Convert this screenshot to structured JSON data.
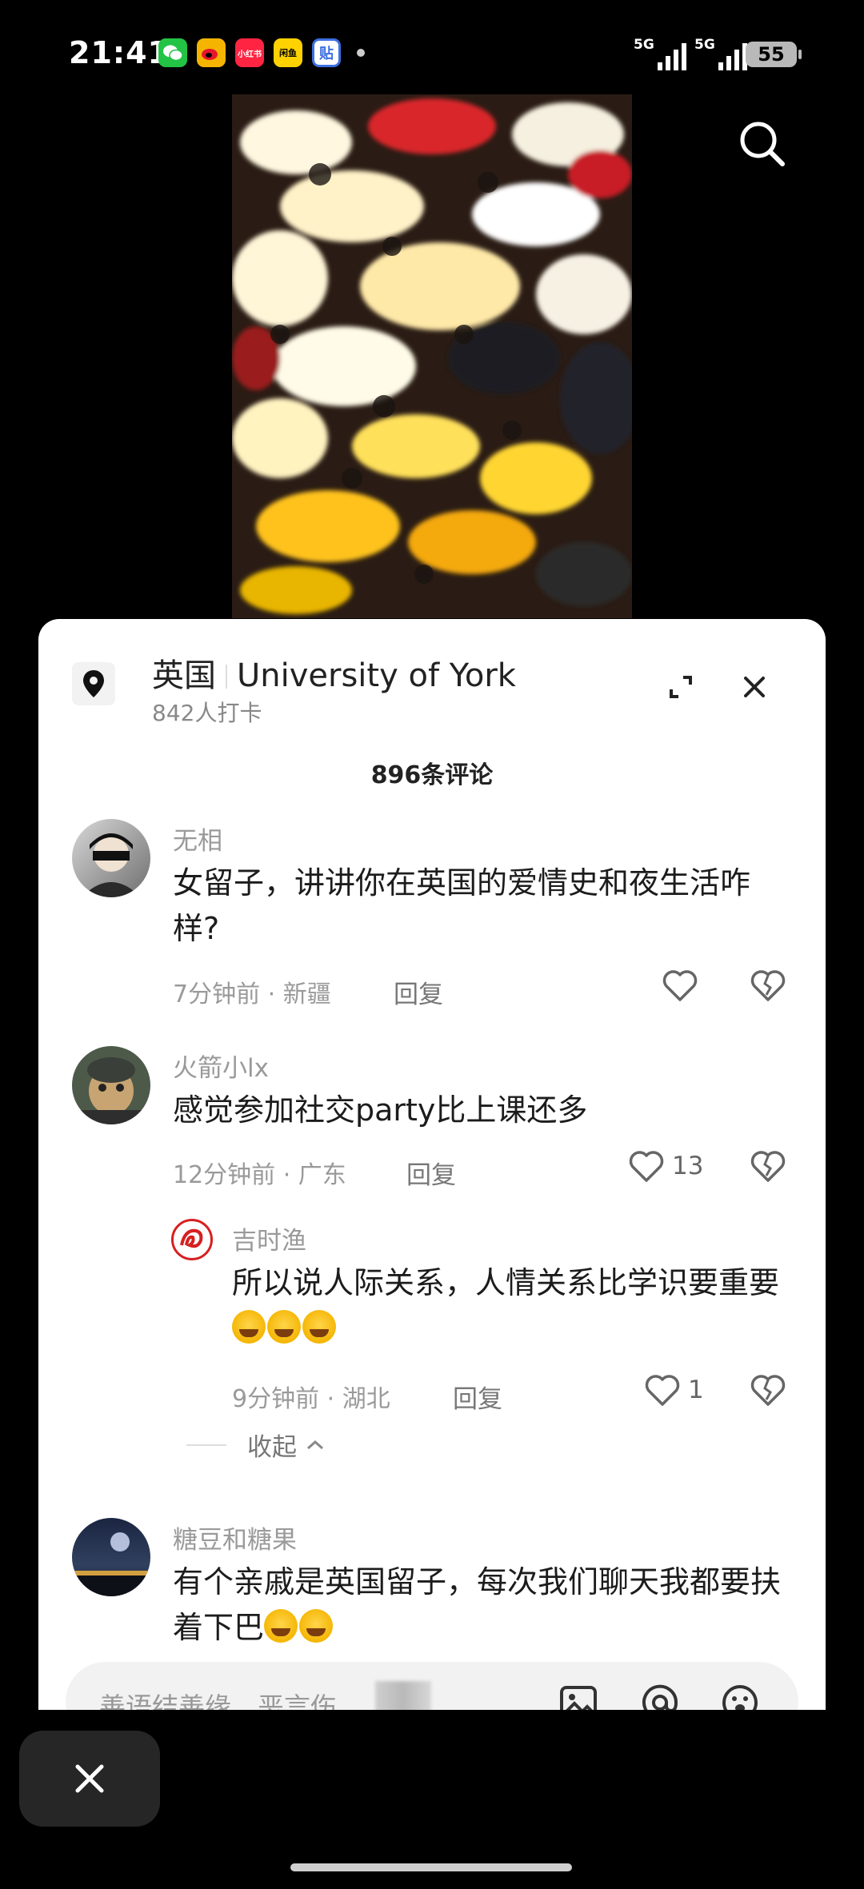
{
  "status_bar": {
    "time": "21:41",
    "network_1": "5G",
    "network_2": "5G",
    "battery": "55",
    "apps": [
      {
        "name": "wechat-icon",
        "color": "#23c345",
        "label": ""
      },
      {
        "name": "weibo-icon",
        "color": "#f5b400",
        "label": ""
      },
      {
        "name": "xiaohongshu-icon",
        "color": "#ff2442",
        "label": "小红书"
      },
      {
        "name": "yellow-app-icon",
        "color": "#ffd200",
        "label": "闲鱼"
      },
      {
        "name": "tieba-icon",
        "color": "#3d6fe0",
        "label": "贴"
      }
    ]
  },
  "location": {
    "country": "英国",
    "name": "University of York",
    "checkins": "842人打卡"
  },
  "comments_count": "896条评论",
  "comments": [
    {
      "user": "无相",
      "text": "女留子，讲讲你在英国的爱情史和夜生活咋样?",
      "time": "7分钟前 · 新疆",
      "reply": "回复",
      "likes": ""
    },
    {
      "user": "火箭小lx",
      "text": "感觉参加社交party比上课还多",
      "time": "12分钟前 · 广东",
      "reply": "回复",
      "likes": "13"
    },
    {
      "user": "吉时渔",
      "text": "所以说人际关系，人情关系比学识要重要",
      "time": "9分钟前 · 湖北",
      "reply": "回复",
      "likes": "1"
    },
    {
      "user": "糖豆和糖果",
      "text": "有个亲戚是英国留子，每次我们聊天我都要扶着下巴",
      "time": "",
      "reply": "",
      "likes": ""
    }
  ],
  "collapse_label": "收起",
  "input": {
    "placeholder": "善语结善缘，恶言伤"
  },
  "colors": {
    "sheet_bg": "#ffffff",
    "name_gray": "#9a9a9a",
    "text": "#1c1c1c"
  }
}
